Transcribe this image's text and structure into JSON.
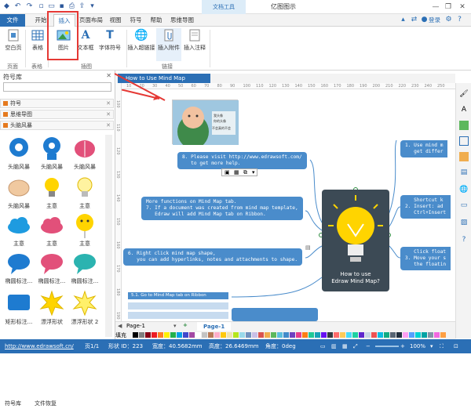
{
  "titlebar": {
    "doc_tools": "文档工具",
    "app_title": "亿图图示",
    "quick_icons": [
      "logo-icon",
      "undo-icon",
      "redo-icon",
      "new-icon",
      "open-icon",
      "save-icon",
      "print-icon",
      "export-icon",
      "more-icon"
    ],
    "window_buttons": [
      "—",
      "❐",
      "✕"
    ]
  },
  "menubar": {
    "tabs": [
      "文件",
      "开始",
      "插入",
      "页面布局",
      "视图",
      "符号",
      "帮助",
      "思维导图"
    ],
    "login": "登录"
  },
  "ribbon": {
    "buttons": [
      {
        "label": "空白页",
        "icon": "blank-page-icon"
      },
      {
        "label": "表格",
        "icon": "table-icon"
      },
      {
        "label": "图片",
        "icon": "picture-icon"
      },
      {
        "label": "文本框",
        "icon": "textbox-icon"
      },
      {
        "label": "字体符号",
        "icon": "font-symbol-icon"
      },
      {
        "label": "插入超链接",
        "icon": "hyperlink-icon"
      },
      {
        "label": "插入附件",
        "icon": "attachment-icon"
      },
      {
        "label": "插入注释",
        "icon": "comment-icon"
      }
    ],
    "groups": [
      "页面",
      "表格",
      "插图",
      "链接"
    ]
  },
  "sidebar": {
    "title": "符号库",
    "close": "✕",
    "search_placeholder": "",
    "libraries": [
      "符号",
      "思维导图",
      "头脑风暴"
    ],
    "shapes": [
      "头脑风暴",
      "头脑风暴",
      "头脑风暴",
      "头脑风暴",
      "主意",
      "主意",
      "主意",
      "主意",
      "主意",
      "椭圆标注...",
      "椭圆标注...",
      "椭圆标注...",
      "矩形标注...",
      "漂浮形状",
      "漂浮形状 2"
    ],
    "tabs": [
      "符号库",
      "文件恢复"
    ]
  },
  "canvas": {
    "doc_tab": "How to Use Mind Map",
    "ruler_h": [
      "10",
      "20",
      "30",
      "40",
      "50",
      "60",
      "70",
      "80",
      "90",
      "100",
      "110",
      "120",
      "130",
      "140",
      "150",
      "160",
      "170",
      "180",
      "190",
      "200",
      "210",
      "220",
      "230",
      "240",
      "250"
    ],
    "ruler_v": [
      "100",
      "110",
      "120",
      "130",
      "140",
      "150",
      "160",
      "170",
      "180",
      "190"
    ],
    "photo_caption": [
      "我头像",
      "你的头像",
      "不会真的不会"
    ],
    "center_title": "How to use\nEdraw Mind Map?",
    "nodes_left": [
      "8. Please visit http://www.edrawsoft.com/\n   to get more help.",
      "More functions on Mind Map tab.\n7. If a document was created from mind map template,\n   Edraw will add Mind Map tab on Ribbon.",
      "6. Right click mind map shape,\n   you can add hyperlinks, notes and attachments to shape."
    ],
    "nodes_right": [
      "1. Use mind m\n   get differ",
      "   Shortcut k\n2. Insert: ad\n   Ctrl+Insert",
      "   Click float\n3. Move your s\n   the floatin"
    ],
    "sub_nodes": [
      "5.1. Go to Mind Map tab on Ribbon"
    ]
  },
  "pagebar": {
    "tabs": [
      "Page-1",
      "Page-1"
    ]
  },
  "palette": {
    "label": "填充",
    "colors": [
      "#000000",
      "#7f7f7f",
      "#880015",
      "#ed1c24",
      "#ff7f27",
      "#fff200",
      "#22b14c",
      "#00a2e8",
      "#3f48cc",
      "#a349a4",
      "#ffffff",
      "#c3c3c3",
      "#b97a57",
      "#ffaec9",
      "#ffc90e",
      "#efe4b0",
      "#b5e61d",
      "#99d9ea",
      "#7092be",
      "#c8bfe7",
      "#d9534f",
      "#f0ad4e",
      "#5cb85c",
      "#5bc0de",
      "#428bca",
      "#6f42c1",
      "#e83e8c",
      "#fd7e14",
      "#20c997",
      "#17a2b8",
      "#6610f2",
      "#343a40",
      "#ff6b6b",
      "#feca57",
      "#48dbfb",
      "#1dd1a1",
      "#5f27cd",
      "#c8d6e5",
      "#ee5253",
      "#0abde3",
      "#10ac84",
      "#576574",
      "#222f3e",
      "#ff9ff3",
      "#54a0ff",
      "#00d2d3",
      "#01a3a4",
      "#8395a7",
      "#f368e0",
      "#ff9f43"
    ]
  },
  "statusbar": {
    "url": "http://www.edrawsoft.cn/",
    "page": "页1/1",
    "shape_id": "形状 ID：223",
    "width": "宽度：40.5682mm",
    "height": "高度：26.6469mm",
    "angle": "角度：0deg",
    "zoom": "100%"
  },
  "colors": {
    "accent": "#2b6fb5",
    "node": "#4a8ccb",
    "center": "#3c4a55",
    "highlight": "#e53935"
  }
}
